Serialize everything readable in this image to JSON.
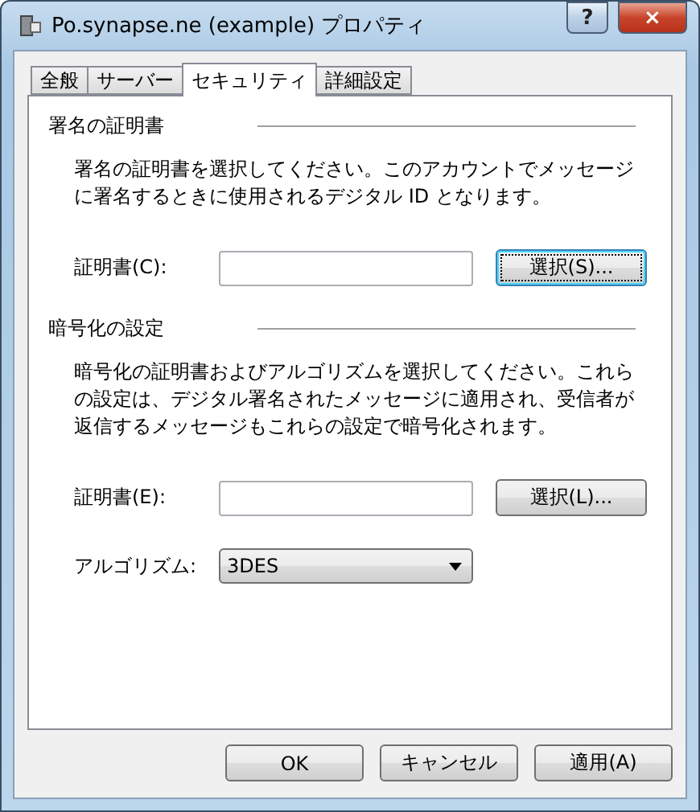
{
  "window": {
    "title": "Po.synapse.ne (example) プロパティ",
    "controls": [
      "?",
      "×"
    ]
  },
  "tabs": [
    {
      "label": "全般",
      "selected": false
    },
    {
      "label": "サーバー",
      "selected": false
    },
    {
      "label": "セキュリティ",
      "selected": true
    },
    {
      "label": "詳細設定",
      "selected": false
    }
  ],
  "sections": [
    {
      "heading": "署名の証明書",
      "description": "署名の証明書を選択してください。このアカウントでメッセージに署名するときに使用されるデジタル ID となります。",
      "rows": [
        {
          "kind": "certificate",
          "label": "証明書(C):",
          "button": "選択(S)...",
          "focused": true
        }
      ]
    },
    {
      "heading": "暗号化の設定",
      "description": "暗号化の証明書およびアルゴリズムを選択してください。これらの設定は、デジタル署名されたメッセージに適用され、受信者が返信するメッセージもこれらの設定で暗号化されます。",
      "rows": [
        {
          "kind": "certificate",
          "label": "証明書(E):",
          "button": "選択(L)...",
          "focused": false
        },
        {
          "kind": "select",
          "label": "アルゴリズム:",
          "value": "3DES"
        }
      ]
    }
  ],
  "buttons": [
    "OK",
    "キャンセル",
    "適用(A)"
  ]
}
